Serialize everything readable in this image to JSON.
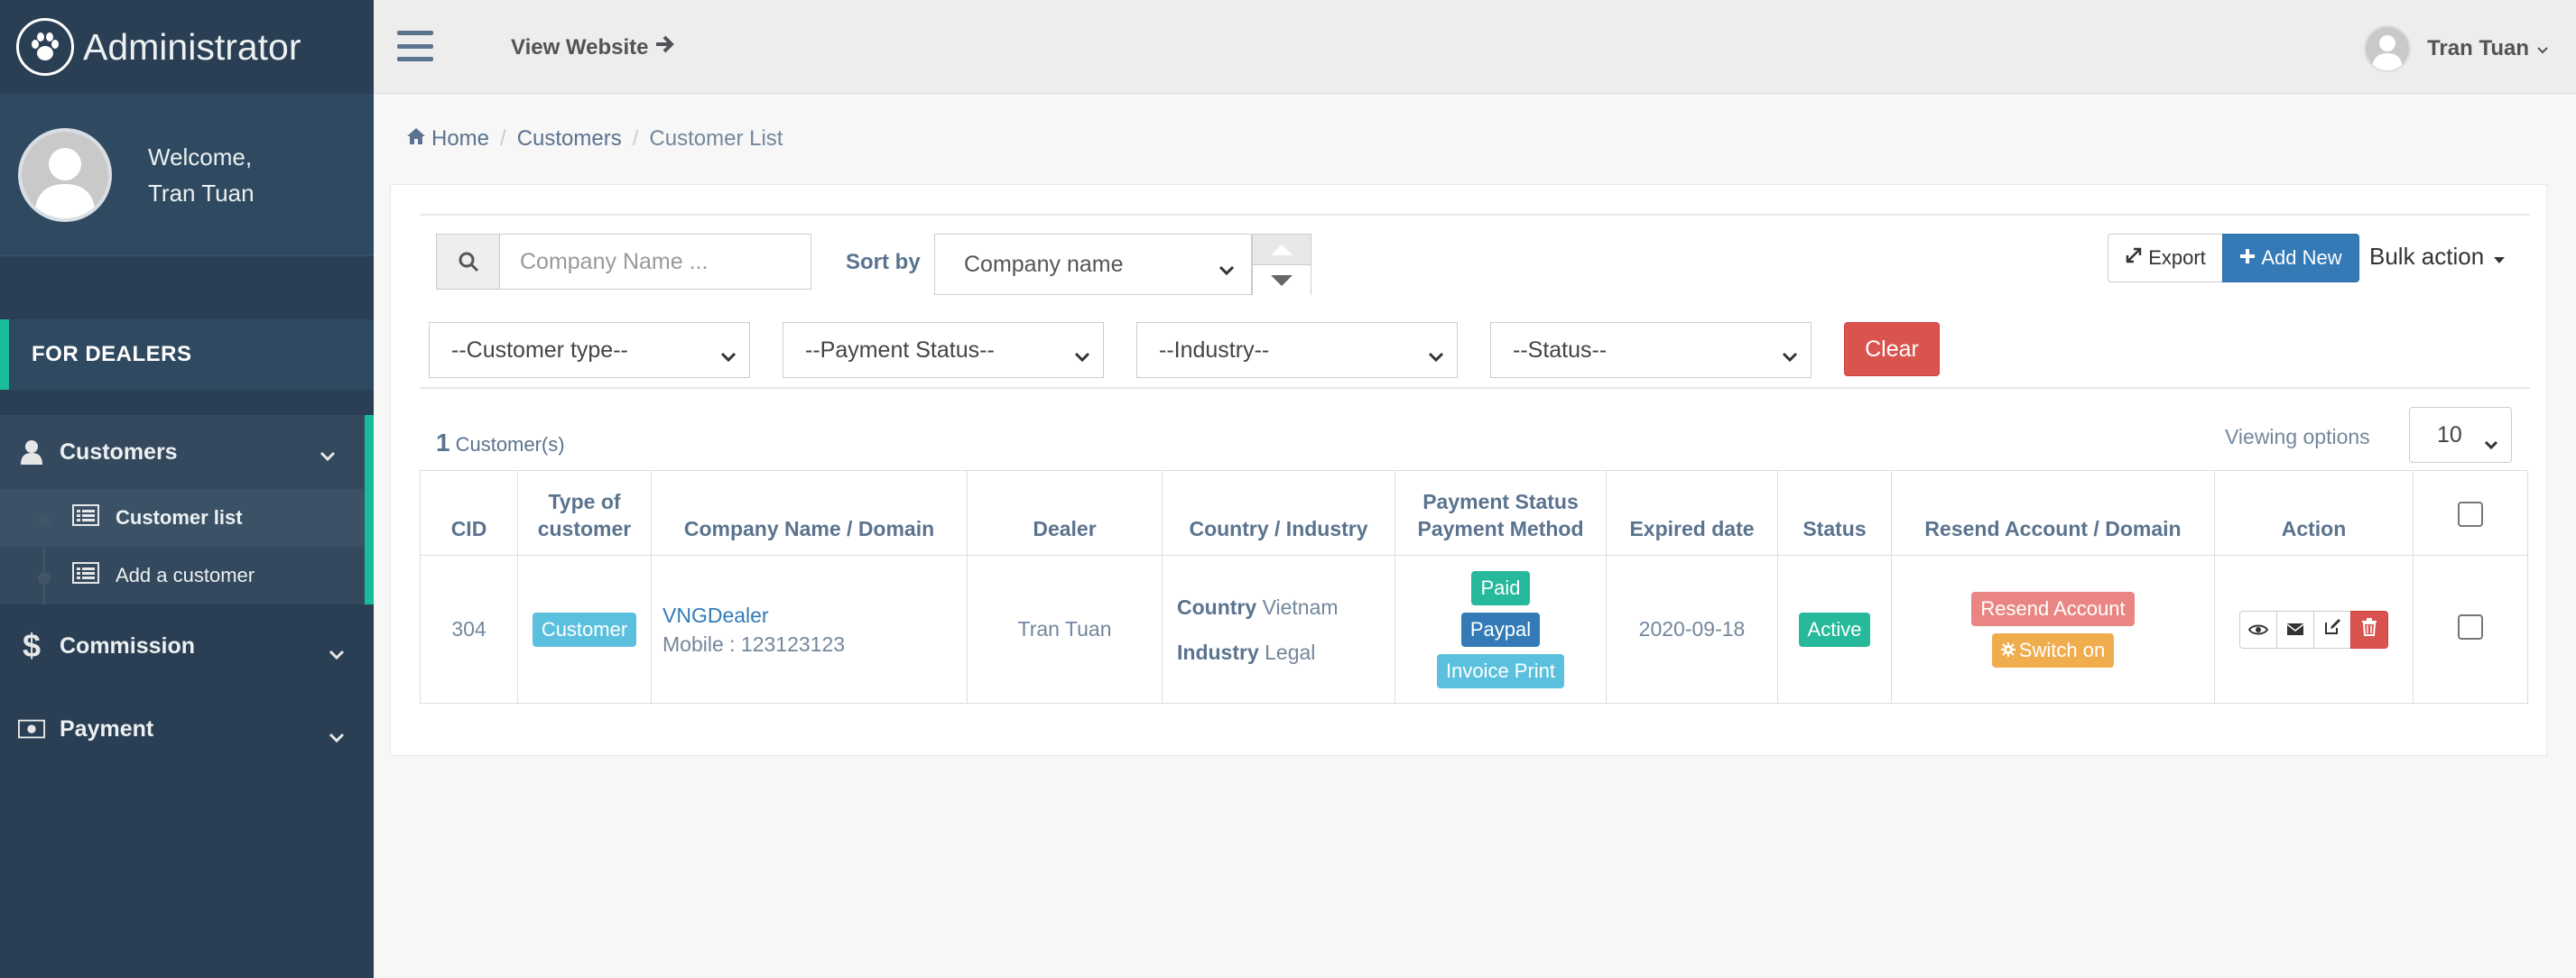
{
  "sidebar": {
    "brand_title": "Administrator",
    "welcome_label": "Welcome,",
    "user_name": "Tran Tuan",
    "section_label": "FOR DEALERS",
    "menu": {
      "customers": "Customers",
      "customer_list": "Customer list",
      "add_customer": "Add a customer",
      "commission": "Commission",
      "payment": "Payment"
    }
  },
  "topnav": {
    "view_website": "View Website",
    "user_name": "Tran Tuan"
  },
  "breadcrumb": [
    "Home",
    "Customers",
    "Customer List"
  ],
  "search": {
    "placeholder": "Company Name ..."
  },
  "sort": {
    "label": "Sort by",
    "selected": "Company name"
  },
  "actions": {
    "export": "Export",
    "add_new": "Add New",
    "bulk": "Bulk action"
  },
  "filters": {
    "customer_type": "--Customer type--",
    "payment_status": "--Payment Status--",
    "industry": "--Industry--",
    "status": "--Status--",
    "clear": "Clear"
  },
  "summary": {
    "count": "1",
    "count_label": "Customer(s)",
    "viewing_label": "Viewing options",
    "per_page": "10"
  },
  "table": {
    "headers": {
      "cid": "CID",
      "type_1": "Type of",
      "type_2": "customer",
      "company": "Company Name / Domain",
      "dealer": "Dealer",
      "country": "Country / Industry",
      "pay_1": "Payment Status",
      "pay_2": "Payment Method",
      "expired": "Expired date",
      "status": "Status",
      "resend": "Resend Account / Domain",
      "action": "Action"
    },
    "rows": [
      {
        "cid": "304",
        "type": "Customer",
        "company": "VNGDealer",
        "mobile": "Mobile : 123123123",
        "dealer": "Tran Tuan",
        "country_label": "Country",
        "country": "Vietnam",
        "industry_label": "Industry",
        "industry": "Legal",
        "payment_status": "Paid",
        "payment_method": "Paypal",
        "invoice": "Invoice Print",
        "expired": "2020-09-18",
        "status": "Active",
        "resend": "Resend Account",
        "switch": "Switch on"
      }
    ]
  },
  "colors": {
    "sidebar_bg": "#2a3f54",
    "accent_green": "#1abb9c",
    "primary": "#337ab7",
    "danger": "#d9534f",
    "info": "#5bc0de",
    "warning": "#f0ad4e",
    "success": "#26b99a"
  },
  "icons": [
    "paw-icon",
    "bars-icon",
    "arrow-right-icon",
    "home-icon",
    "user-icon",
    "list-icon",
    "dollar-icon",
    "money-icon",
    "search-icon",
    "expand-icon",
    "plus-icon",
    "caret-down-icon",
    "eye-icon",
    "envelope-icon",
    "edit-icon",
    "trash-icon",
    "gear-icon",
    "chevron-down-icon"
  ]
}
